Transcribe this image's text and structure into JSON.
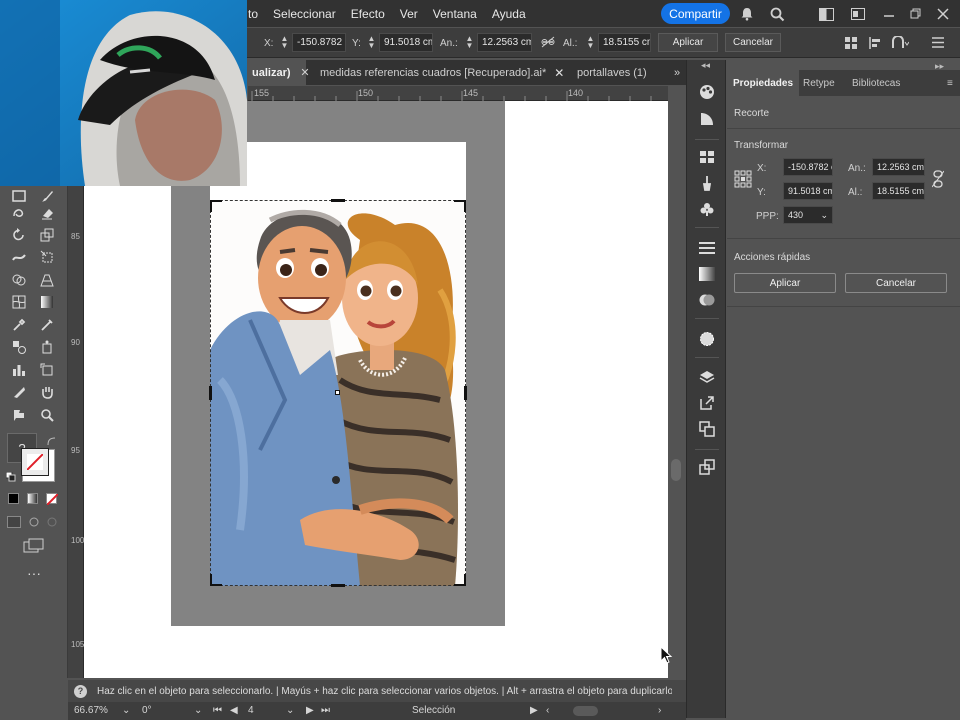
{
  "menu": {
    "items": [
      "to",
      "Seleccionar",
      "Efecto",
      "Ver",
      "Ventana",
      "Ayuda"
    ],
    "share_label": "Compartir"
  },
  "controlbar": {
    "x_label": "X:",
    "x_value": "-150.8782 cm",
    "y_label": "Y:",
    "y_value": "91.5018 cm",
    "w_label": "An.:",
    "w_value": "12.2563 cm",
    "h_label": "Al.:",
    "h_value": "18.5155 cm",
    "apply_label": "Aplicar",
    "cancel_label": "Cancelar"
  },
  "tabs": [
    {
      "label": "ualizar)",
      "active": true
    },
    {
      "label": "medidas referencias cuadros [Recuperado].ai*",
      "active": false
    },
    {
      "label": "portallaves (1)",
      "active": false
    }
  ],
  "ruler": {
    "h_ticks": [
      "155",
      "150",
      "145",
      "140"
    ],
    "v_ticks": [
      "85",
      "90",
      "95",
      "100",
      "105"
    ]
  },
  "panel": {
    "tabs": [
      "Propiedades",
      "Retype",
      "Bibliotecas"
    ],
    "section_title": "Recorte",
    "transform_title": "Transformar",
    "x_label": "X:",
    "x_value": "-150.8782 c",
    "y_label": "Y:",
    "y_value": "91.5018 cm",
    "w_label": "An.:",
    "w_value": "12.2563 cm",
    "h_label": "Al.:",
    "h_value": "18.5155 cm",
    "ppp_label": "PPP:",
    "ppp_value": "430",
    "quick_actions_title": "Acciones rápidas",
    "apply_label": "Aplicar",
    "cancel_label": "Cancelar"
  },
  "status": {
    "hint": "Haz clic en el objeto para seleccionarlo. | Mayús + haz clic para seleccionar varios objetos. | Alt + arrastra el objeto para duplicarlo"
  },
  "bottombar": {
    "zoom": "66.67%",
    "rotation": "0°",
    "artboard": "4",
    "tool": "Selección"
  },
  "colors": {
    "accent": "#1473e6",
    "chrome_dark": "#323232",
    "panel": "#535353"
  }
}
